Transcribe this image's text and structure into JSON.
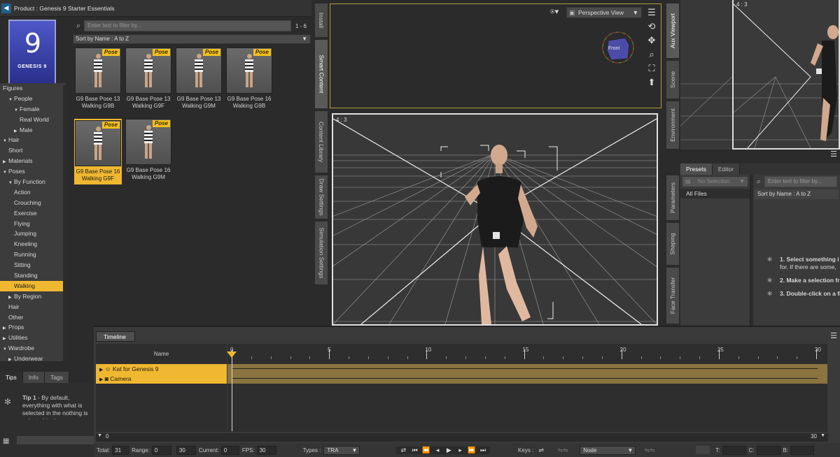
{
  "product_header": {
    "back_icon": "arrow-left-icon",
    "title": "Product : Genesis 9 Starter Essentials"
  },
  "product_icon": {
    "glyph": "9",
    "label": "GENESIS 9"
  },
  "filter": {
    "placeholder": "Enter text to filter by...",
    "count": "1 - 6"
  },
  "sort": {
    "label": "Sort by Name : A to Z"
  },
  "tree": [
    {
      "label": "Figures",
      "indent": 0,
      "arrow": ""
    },
    {
      "label": "People",
      "indent": 1,
      "arrow": "▼"
    },
    {
      "label": "Female",
      "indent": 2,
      "arrow": "▼"
    },
    {
      "label": "Real World",
      "indent": 3,
      "arrow": ""
    },
    {
      "label": "Male",
      "indent": 2,
      "arrow": "▶"
    },
    {
      "label": "Hair",
      "indent": 0,
      "arrow": "▼"
    },
    {
      "label": "Short",
      "indent": 1,
      "arrow": ""
    },
    {
      "label": "Materials",
      "indent": 0,
      "arrow": "▶"
    },
    {
      "label": "Poses",
      "indent": 0,
      "arrow": "▼"
    },
    {
      "label": "By Function",
      "indent": 1,
      "arrow": "▼"
    },
    {
      "label": "Action",
      "indent": 2,
      "arrow": ""
    },
    {
      "label": "Crouching",
      "indent": 2,
      "arrow": ""
    },
    {
      "label": "Exercise",
      "indent": 2,
      "arrow": ""
    },
    {
      "label": "Flying",
      "indent": 2,
      "arrow": ""
    },
    {
      "label": "Jumping",
      "indent": 2,
      "arrow": ""
    },
    {
      "label": "Kneeling",
      "indent": 2,
      "arrow": ""
    },
    {
      "label": "Running",
      "indent": 2,
      "arrow": ""
    },
    {
      "label": "Sitting",
      "indent": 2,
      "arrow": ""
    },
    {
      "label": "Standing",
      "indent": 2,
      "arrow": ""
    },
    {
      "label": "Walking",
      "indent": 2,
      "arrow": "",
      "selected": true
    },
    {
      "label": "By Region",
      "indent": 1,
      "arrow": "▶"
    },
    {
      "label": "Hair",
      "indent": 1,
      "arrow": ""
    },
    {
      "label": "Other",
      "indent": 1,
      "arrow": ""
    },
    {
      "label": "Props",
      "indent": 0,
      "arrow": "▶"
    },
    {
      "label": "Utilities",
      "indent": 0,
      "arrow": "▶"
    },
    {
      "label": "Wardrobe",
      "indent": 0,
      "arrow": "▼"
    },
    {
      "label": "Underwear",
      "indent": 1,
      "arrow": "▶"
    }
  ],
  "thumbnails": [
    {
      "badge": "Pose",
      "line1": "G9 Base Pose 13",
      "line2": "Walking G9B"
    },
    {
      "badge": "Pose",
      "line1": "G9 Base Pose 13",
      "line2": "Walking G9F"
    },
    {
      "badge": "Pose",
      "line1": "G9 Base Pose 13",
      "line2": "Walking G9M"
    },
    {
      "badge": "Pose",
      "line1": "G9 Base Pose 16",
      "line2": "Walking G9B"
    },
    {
      "badge": "Pose",
      "line1": "G9 Base Pose 16",
      "line2": "Walking G9F",
      "selected": true
    },
    {
      "badge": "Pose",
      "line1": "G9 Base Pose 16",
      "line2": "Walking G9M"
    }
  ],
  "left_vtabs": [
    "Install",
    "Smart Content",
    "Content Library",
    "Draw Settings",
    "Simulation Settings"
  ],
  "right_vtabs": [
    "Aux Viewport",
    "Scene",
    "Environment",
    "Parameters",
    "Shaping",
    "Face Transfer"
  ],
  "tips": {
    "tabs": [
      "Tips",
      "Info",
      "Tags"
    ],
    "text_bold": "Tip 1",
    "text": " - By default, everything with what is selected in the nothing is selected in the"
  },
  "viewport": {
    "view_select": "Perspective View",
    "aspect": "4 : 3",
    "cube_label": "Front",
    "aux_aspect": "4 : 3"
  },
  "presets": {
    "tabs": [
      "Presets",
      "Editor"
    ],
    "selection": "No Selection",
    "filter_placeholder": "Enter text to filter by...",
    "all_files": "All Files",
    "sort": "Sort by Name : A to Z",
    "instructions": [
      {
        "num": "1.",
        "bold": "Select something i",
        "rest": "for. If there are some,"
      },
      {
        "num": "2.",
        "bold": "Make a selection fr",
        "rest": ""
      },
      {
        "num": "3.",
        "bold": "Double-click on a fi",
        "rest": ""
      }
    ]
  },
  "timeline": {
    "tab": "Timeline",
    "name_header": "Name",
    "ticks": [
      "0",
      "5",
      "10",
      "15",
      "20",
      "25",
      "30"
    ],
    "rows": [
      {
        "label": "Kat for Genesis 9",
        "icon": "figure-icon"
      },
      {
        "label": "Camera",
        "icon": "camera-icon"
      }
    ],
    "range_left": "0",
    "range_right": "30",
    "total_label": "Total:",
    "total": "31",
    "range_label": "Range:",
    "range_start": "0",
    "range_end": "30",
    "current_label": "Current:",
    "current": "0",
    "fps_label": "FPS:",
    "fps": "30",
    "types_label": "Types :",
    "types": "TRA",
    "keys_label": "Keys :",
    "node": "Node",
    "t_label": "T:",
    "c_label": "C:",
    "b_label": "B:"
  }
}
